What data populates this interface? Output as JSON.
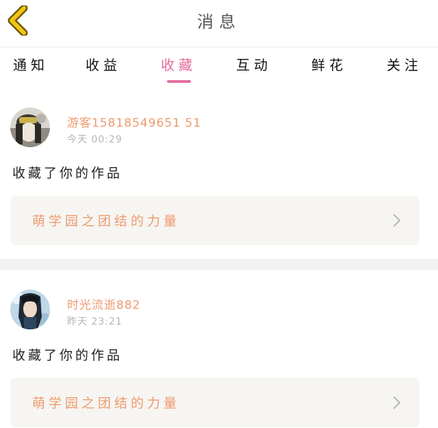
{
  "header": {
    "title": "消息"
  },
  "tabs": [
    {
      "label": "通知"
    },
    {
      "label": "收益"
    },
    {
      "label": "收藏"
    },
    {
      "label": "互动"
    },
    {
      "label": "鲜花"
    },
    {
      "label": "关注"
    }
  ],
  "active_tab": "收藏",
  "messages": [
    {
      "username": "游客15818549651 51",
      "time": "今天 00:29",
      "action": "收藏了你的作品",
      "work_title": "萌学园之团结的力量"
    },
    {
      "username": "时光流逝882",
      "time": "昨天 23:21",
      "action": "收藏了你的作品",
      "work_title": "萌学园之团结的力量"
    }
  ],
  "colors": {
    "accent_pink": "#e5699a",
    "username_orange": "#ee9a6f",
    "back_arrow_yellow": "#f2c511",
    "card_bg": "#f6f5f1"
  },
  "icons": {
    "back": "back-arrow-icon",
    "card_arrow": "chevron-right-icon"
  }
}
